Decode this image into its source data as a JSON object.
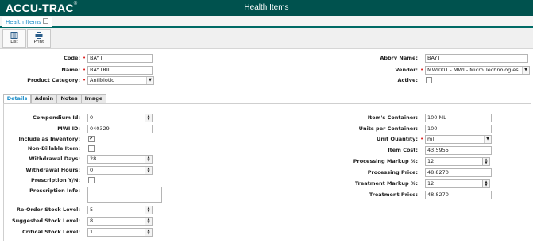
{
  "app": {
    "brand": "ACCU-TRAC",
    "brand_mark": "®",
    "title": "Health Items"
  },
  "doc_tab": {
    "label": "Health Items"
  },
  "toolbar": {
    "list_label": "List",
    "print_label": "Print"
  },
  "header_left": {
    "code_label": "Code:",
    "code_value": "BAYT",
    "name_label": "Name:",
    "name_value": "BAYTRIL",
    "category_label": "Product Category:",
    "category_value": "Antibiotic"
  },
  "header_right": {
    "abbrv_label": "Abbrv Name:",
    "abbrv_value": "BAYT",
    "vendor_label": "Vendor:",
    "vendor_value": "MWI001 - MWI - Micro Technologies",
    "active_label": "Active:"
  },
  "tabs": [
    "Details",
    "Admin",
    "Notes",
    "Image"
  ],
  "details_left": {
    "compendium_label": "Compendium Id:",
    "compendium_value": "0",
    "mwi_label": "MWI ID:",
    "mwi_value": "040329",
    "include_inv_label": "Include as Inventory:",
    "nonbillable_label": "Non-Billable Item:",
    "wd_days_label": "Withdrawal Days:",
    "wd_days_value": "28",
    "wd_hours_label": "Withdrawal Hours:",
    "wd_hours_value": "0",
    "rx_yn_label": "Prescription Y/N:",
    "rx_info_label": "Prescription Info:",
    "reorder_label": "Re-Order Stock Level:",
    "reorder_value": "5",
    "suggested_label": "Suggested Stock Level:",
    "suggested_value": "8",
    "critical_label": "Critical Stock Level:",
    "critical_value": "1"
  },
  "details_right": {
    "container_label": "Item's Container:",
    "container_value": "100 ML",
    "units_label": "Units per Container:",
    "units_value": "100",
    "unit_qty_label": "Unit Quantity:",
    "unit_qty_value": "ml",
    "item_cost_label": "Item Cost:",
    "item_cost_value": "43.5955",
    "proc_markup_label": "Processing Markup %:",
    "proc_markup_value": "12",
    "proc_price_label": "Processing Price:",
    "proc_price_value": "48.8270",
    "treat_markup_label": "Treatment Markup %:",
    "treat_markup_value": "12",
    "treat_price_label": "Treatment Price:",
    "treat_price_value": "48.8270"
  },
  "checks": {
    "include_inventory": true,
    "non_billable": false,
    "prescription": false,
    "active": false,
    "check_glyph": "✔"
  },
  "icons": [
    "list-icon",
    "print-icon",
    "spin-arrows-icon",
    "dropdown-arrow-icon"
  ],
  "colors": {
    "header": "#00524e",
    "accent": "#1a8cc8",
    "required": "#d22"
  }
}
